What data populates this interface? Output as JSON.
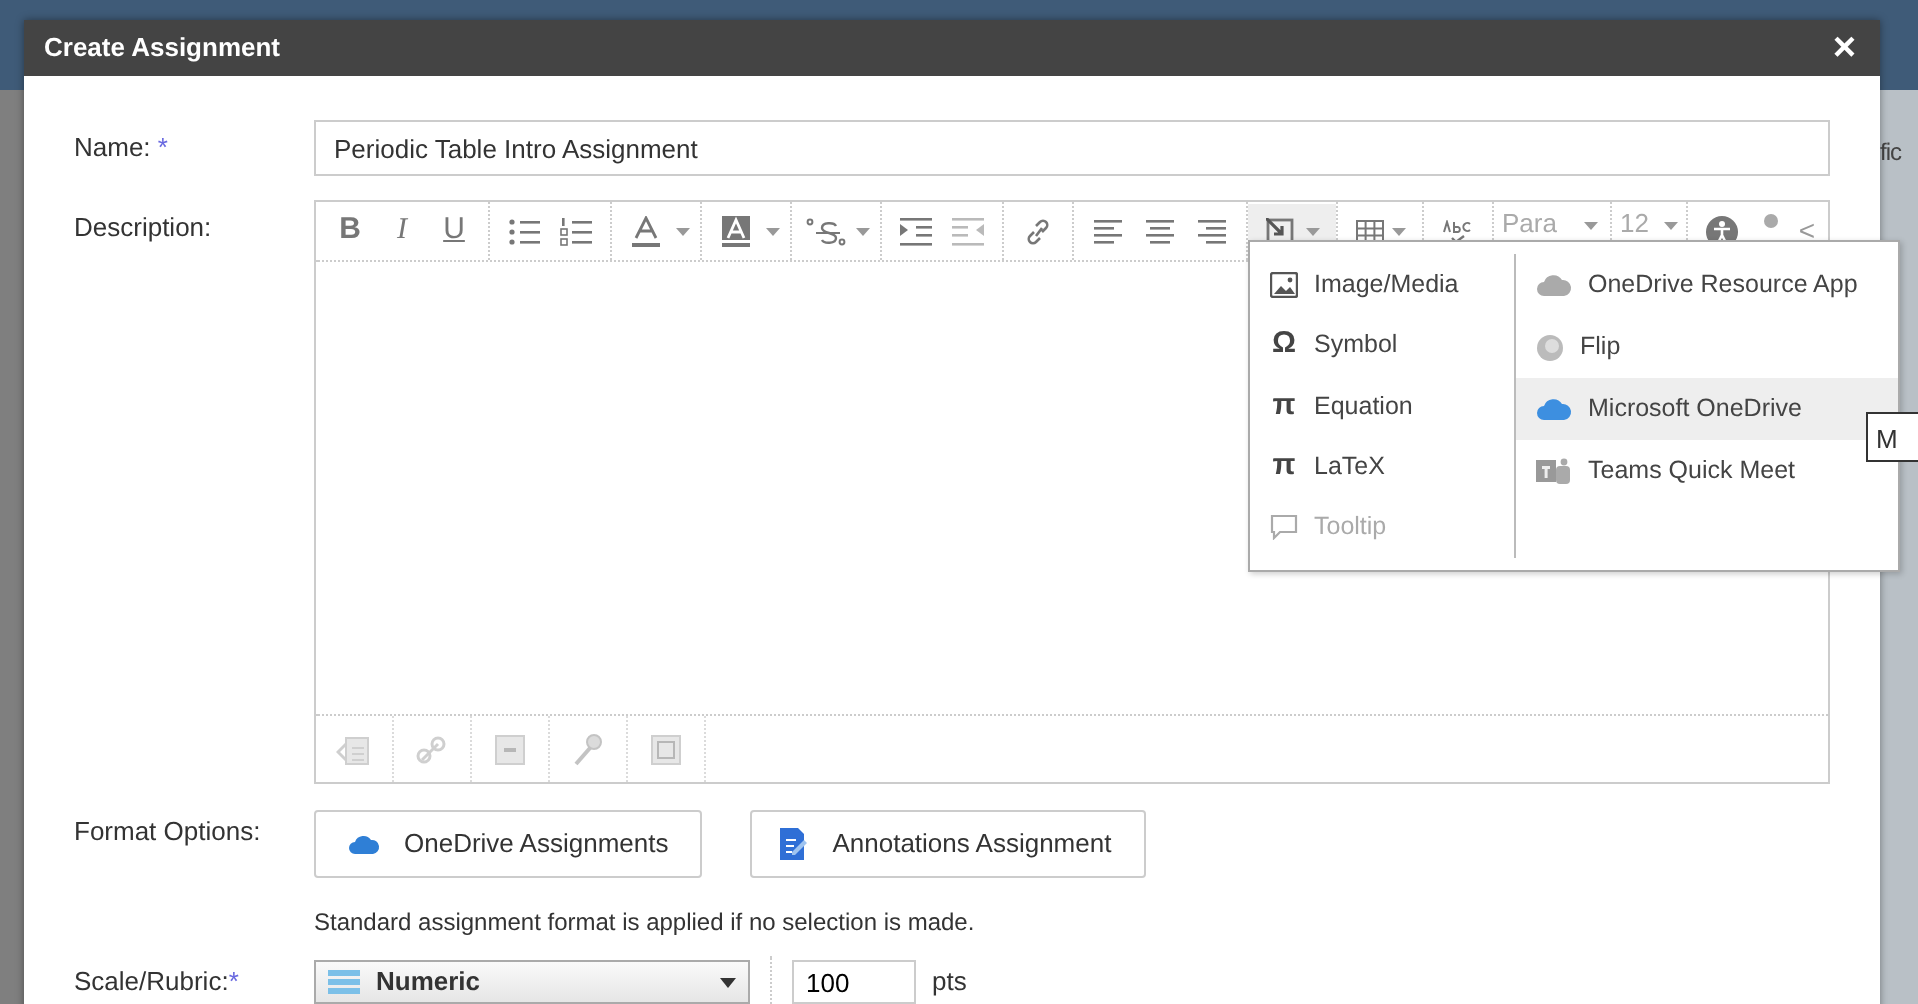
{
  "background": {
    "right_fragment": "fic"
  },
  "dialog": {
    "title": "Create Assignment",
    "close": "×"
  },
  "name_field": {
    "label": "Name:",
    "required_mark": "*",
    "value": "Periodic Table Intro Assignment"
  },
  "description": {
    "label": "Description:",
    "toolbar": {
      "letters": [
        "B",
        "I",
        "U"
      ],
      "paragraph": "Para",
      "font_size": "12",
      "collapse": "<"
    },
    "insert_menu": {
      "expanded": true,
      "columns": [
        [
          {
            "label": "Image/Media",
            "disabled": false,
            "selected": false
          },
          {
            "label": "Symbol",
            "symbol": "Ω",
            "disabled": false,
            "selected": false
          },
          {
            "label": "Equation",
            "symbol": "π",
            "disabled": false,
            "selected": false
          },
          {
            "label": "LaTeX",
            "symbol": "π",
            "disabled": false,
            "selected": false
          },
          {
            "label": "Tooltip",
            "disabled": true,
            "selected": false
          }
        ],
        [
          {
            "label": "OneDrive Resource App",
            "disabled": false,
            "selected": false
          },
          {
            "label": "Flip",
            "disabled": false,
            "selected": false
          },
          {
            "label": "Microsoft OneDrive",
            "disabled": false,
            "selected": true
          },
          {
            "label": "Teams Quick Meet",
            "disabled": false,
            "selected": false
          }
        ]
      ]
    },
    "bottom_toolbar": [
      {
        "disabled": true
      },
      {
        "disabled": true
      },
      {
        "disabled": true
      },
      {
        "disabled": true
      },
      {
        "disabled": true
      }
    ]
  },
  "tooltip": "M",
  "format_options": {
    "label": "Format Options:",
    "buttons": [
      "OneDrive Assignments",
      "Annotations Assignment"
    ],
    "hint": "Standard assignment format is applied if no selection is made."
  },
  "scale": {
    "label": "Scale/Rubric:",
    "required_mark": "*",
    "select": "Numeric",
    "points": "100",
    "unit": "pts"
  }
}
